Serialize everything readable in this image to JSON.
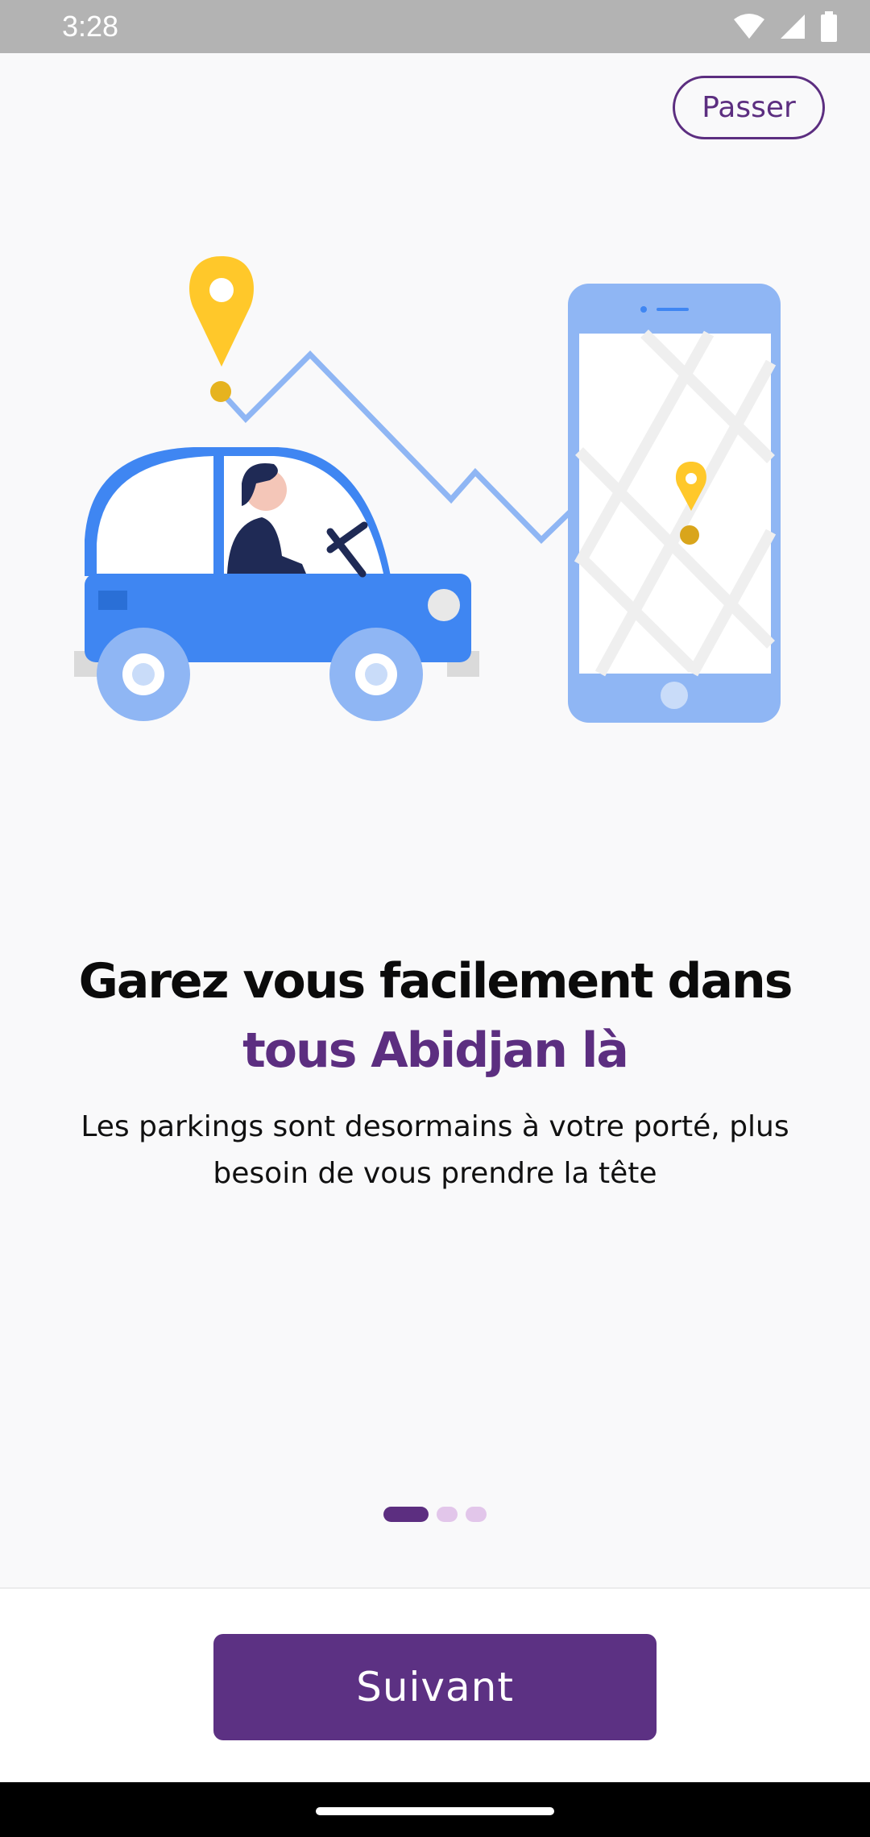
{
  "status_bar": {
    "time": "3:28",
    "icons": [
      "wifi-icon",
      "signal-icon",
      "battery-icon"
    ]
  },
  "onboarding": {
    "skip_label": "Passer",
    "title_line1": "Garez vous facilement dans",
    "title_line2": "tous Abidjan là",
    "subtitle": "Les parkings sont desormains à votre porté, plus besoin de vous prendre la tête",
    "page_indicator": {
      "current": 1,
      "total": 3
    },
    "next_label": "Suivant"
  },
  "colors": {
    "brand": "#5c2e80",
    "dot_inactive": "#e2c6ea",
    "car_blue": "#3f86f2",
    "phone_blue": "#8fb6f4",
    "pin_yellow": "#ffc82a"
  }
}
